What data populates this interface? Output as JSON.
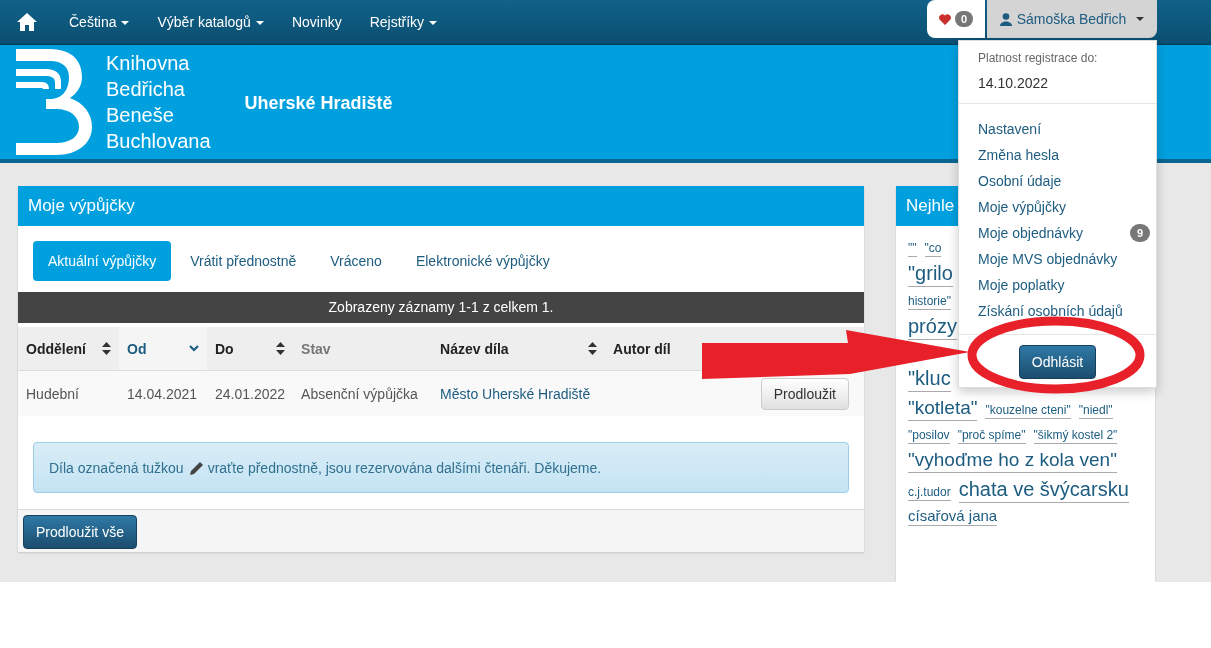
{
  "nav": {
    "menu": [
      {
        "label": "Čeština",
        "dropdown": true
      },
      {
        "label": "Výběr katalogů",
        "dropdown": true
      },
      {
        "label": "Novinky",
        "dropdown": false
      },
      {
        "label": "Rejstříky",
        "dropdown": true
      }
    ]
  },
  "favorites": {
    "count": "0"
  },
  "user": {
    "name": "Sámoška Bedřich",
    "expanded": true
  },
  "header": {
    "logo_lines": [
      "Knihovna",
      "Bedřicha",
      "Beneše",
      "Buchlovana"
    ],
    "city": "Uherské Hradiště"
  },
  "loans": {
    "title": "Moje výpůjčky",
    "tabs": [
      {
        "label": "Aktuální výpůjčky",
        "selected": true
      },
      {
        "label": "Vrátit přednostně",
        "selected": false
      },
      {
        "label": "Vráceno",
        "selected": false
      },
      {
        "label": "Elektronické výpůjčky",
        "selected": false
      }
    ],
    "summary": "Zobrazeny záznamy 1-1 z celkem 1.",
    "columns": [
      {
        "label": "Oddělení",
        "sortable": true,
        "sorted": false,
        "muted": false
      },
      {
        "label": "Od",
        "sortable": true,
        "sorted": true,
        "muted": false
      },
      {
        "label": "Do",
        "sortable": true,
        "sorted": false,
        "muted": false
      },
      {
        "label": "Stav",
        "sortable": false,
        "sorted": false,
        "muted": true
      },
      {
        "label": "Název díla",
        "sortable": true,
        "sorted": false,
        "muted": false
      },
      {
        "label": "Autor díl",
        "sortable": false,
        "sorted": false,
        "muted": false
      }
    ],
    "rows": [
      {
        "cells": [
          "Hudební",
          "14.04.2021",
          "24.01.2022",
          "Absenční výpůjčka",
          "Město Uherské Hradiště"
        ],
        "action": "Prodloužit"
      }
    ],
    "notice_before": "Díla označená tužkou",
    "notice_after": "vraťte přednostně, jsou rezervována dalšími čtenáři. Děkujeme.",
    "renew_all": "Prodloužit vše"
  },
  "popular": {
    "title": "Nejhle",
    "tags": [
      {
        "text": "\"\"",
        "kind": "small"
      },
      {
        "text": "\"co",
        "kind": "small"
      },
      {
        "text": "\"grilo",
        "kind": "xlarge"
      },
      {
        "text": "historie\"",
        "kind": "small"
      },
      {
        "text": "prózy",
        "kind": "xlarge"
      },
      {
        "text": "\"kluc",
        "kind": "xlarge"
      },
      {
        "text": "\"kotleta\"",
        "kind": "large"
      },
      {
        "text": "\"kouzelne cteni\"",
        "kind": "small"
      },
      {
        "text": "\"niedl\"",
        "kind": "small"
      },
      {
        "text": "\"posilov",
        "kind": "small"
      },
      {
        "text": "\"proč spíme\"",
        "kind": "small"
      },
      {
        "text": "\"šikmý kostel 2\"",
        "kind": "small"
      },
      {
        "text": "\"vyhoďme ho z kola ven\"",
        "kind": "large"
      },
      {
        "text": "c.j.tudor",
        "kind": "small"
      },
      {
        "text": "chata ve švýcarsku",
        "kind": "xlarge"
      },
      {
        "text": "císařová jana",
        "kind": "medium"
      }
    ]
  },
  "user_menu": {
    "validity_label": "Platnost registrace do:",
    "validity_date": "14.10.2022",
    "items": [
      {
        "label": "Nastavení"
      },
      {
        "label": "Změna hesla"
      },
      {
        "label": "Osobní údaje"
      },
      {
        "label": "Moje výpůjčky"
      },
      {
        "label": "Moje objednávky",
        "badge": "9"
      },
      {
        "label": "Moje MVS objednávky"
      },
      {
        "label": "Moje poplatky"
      },
      {
        "label": "Získání osobních údajů"
      }
    ],
    "logout": "Odhlásit"
  }
}
